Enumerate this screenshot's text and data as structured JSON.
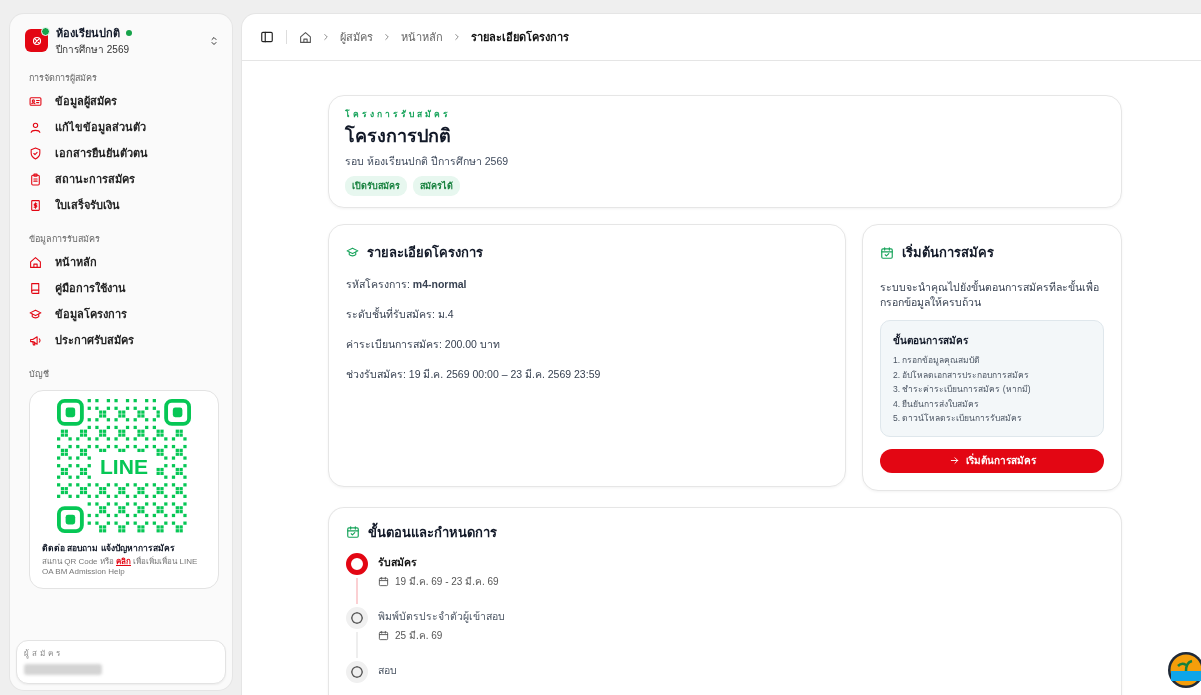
{
  "sidebar": {
    "org_name": "ห้องเรียนปกติ",
    "org_subtitle": "ปีการศึกษา 2569",
    "sections": [
      {
        "label": "การจัดการผู้สมัคร",
        "items": [
          {
            "label": "ข้อมูลผู้สมัคร",
            "kind": "idcard"
          },
          {
            "label": "แก้ไขข้อมูลส่วนตัว",
            "kind": "user"
          },
          {
            "label": "เอกสารยืนยันตัวตน",
            "kind": "shield"
          },
          {
            "label": "สถานะการสมัคร",
            "kind": "clipboard"
          },
          {
            "label": "ใบเสร็จรับเงิน",
            "kind": "receipt"
          }
        ]
      },
      {
        "label": "ข้อมูลการรับสมัคร",
        "items": [
          {
            "label": "หน้าหลัก",
            "kind": "home"
          },
          {
            "label": "คู่มือการใช้งาน",
            "kind": "book"
          },
          {
            "label": "ข้อมูลโครงการ",
            "kind": "cap"
          },
          {
            "label": "ประกาศรับสมัคร",
            "kind": "megaphone"
          }
        ]
      }
    ],
    "account_label": "บัญชี",
    "line_card": {
      "qr_text": "LINE",
      "title": "ติดต่อ สอบถาม แจ้งปัญหาการสมัคร",
      "text_before": "สแกน QR Code หรือ",
      "link": "คลิก",
      "text_after": "เพื่อเพิ่มเพื่อน LINE OA BM Admission Help"
    },
    "user": {
      "label": "ผู้สมัคร"
    }
  },
  "breadcrumb": [
    {
      "label": "ผู้สมัคร",
      "current": false
    },
    {
      "label": "หน้าหลัก",
      "current": false
    },
    {
      "label": "รายละเอียดโครงการ",
      "current": true
    }
  ],
  "hero": {
    "eyebrow": "โครงการรับสมัคร",
    "title": "โครงการปกติ",
    "subtitle": "รอบ ห้องเรียนปกติ ปีการศึกษา 2569",
    "tags": [
      "เปิดรับสมัคร",
      "สมัครได้"
    ]
  },
  "details": {
    "title": "รายละเอียดโครงการ",
    "rows": [
      "รหัสโครงการ: **m4-normal**",
      "ระดับชั้นที่รับสมัคร: ม.4",
      "ค่าระเบียนการสมัคร: 200.00 บาท",
      "ช่วงรับสมัคร: 19 มี.ค. 2569 00:00 – 23 มี.ค. 2569 23:59"
    ]
  },
  "start": {
    "title": "เริ่มต้นการสมัคร",
    "description": "ระบบจะนำคุณไปยังขั้นตอนการสมัครทีละขั้นเพื่อกรอกข้อมูลให้ครบถ้วน",
    "steps_title": "ขั้นตอนการสมัคร",
    "steps": [
      "1. กรอกข้อมูลคุณสมบัติ",
      "2. อัปโหลดเอกสารประกอบการสมัคร",
      "3. ชำระค่าระเบียนการสมัคร (หากมี)",
      "4. ยืนยันการส่งใบสมัคร",
      "5. ดาวน์โหลดระเบียนการรับสมัคร"
    ],
    "button": "เริ่มต้นการสมัคร"
  },
  "timeline": {
    "title": "ขั้นตอนและกำหนดการ",
    "items": [
      {
        "label": "รับสมัคร",
        "date": "19 มี.ค. 69 - 23 มี.ค. 69",
        "current": true
      },
      {
        "label": "พิมพ์บัตรประจำตัวผู้เข้าสอบ",
        "date": "25 มี.ค. 69",
        "current": false
      },
      {
        "label": "สอบ",
        "current": false
      }
    ]
  }
}
